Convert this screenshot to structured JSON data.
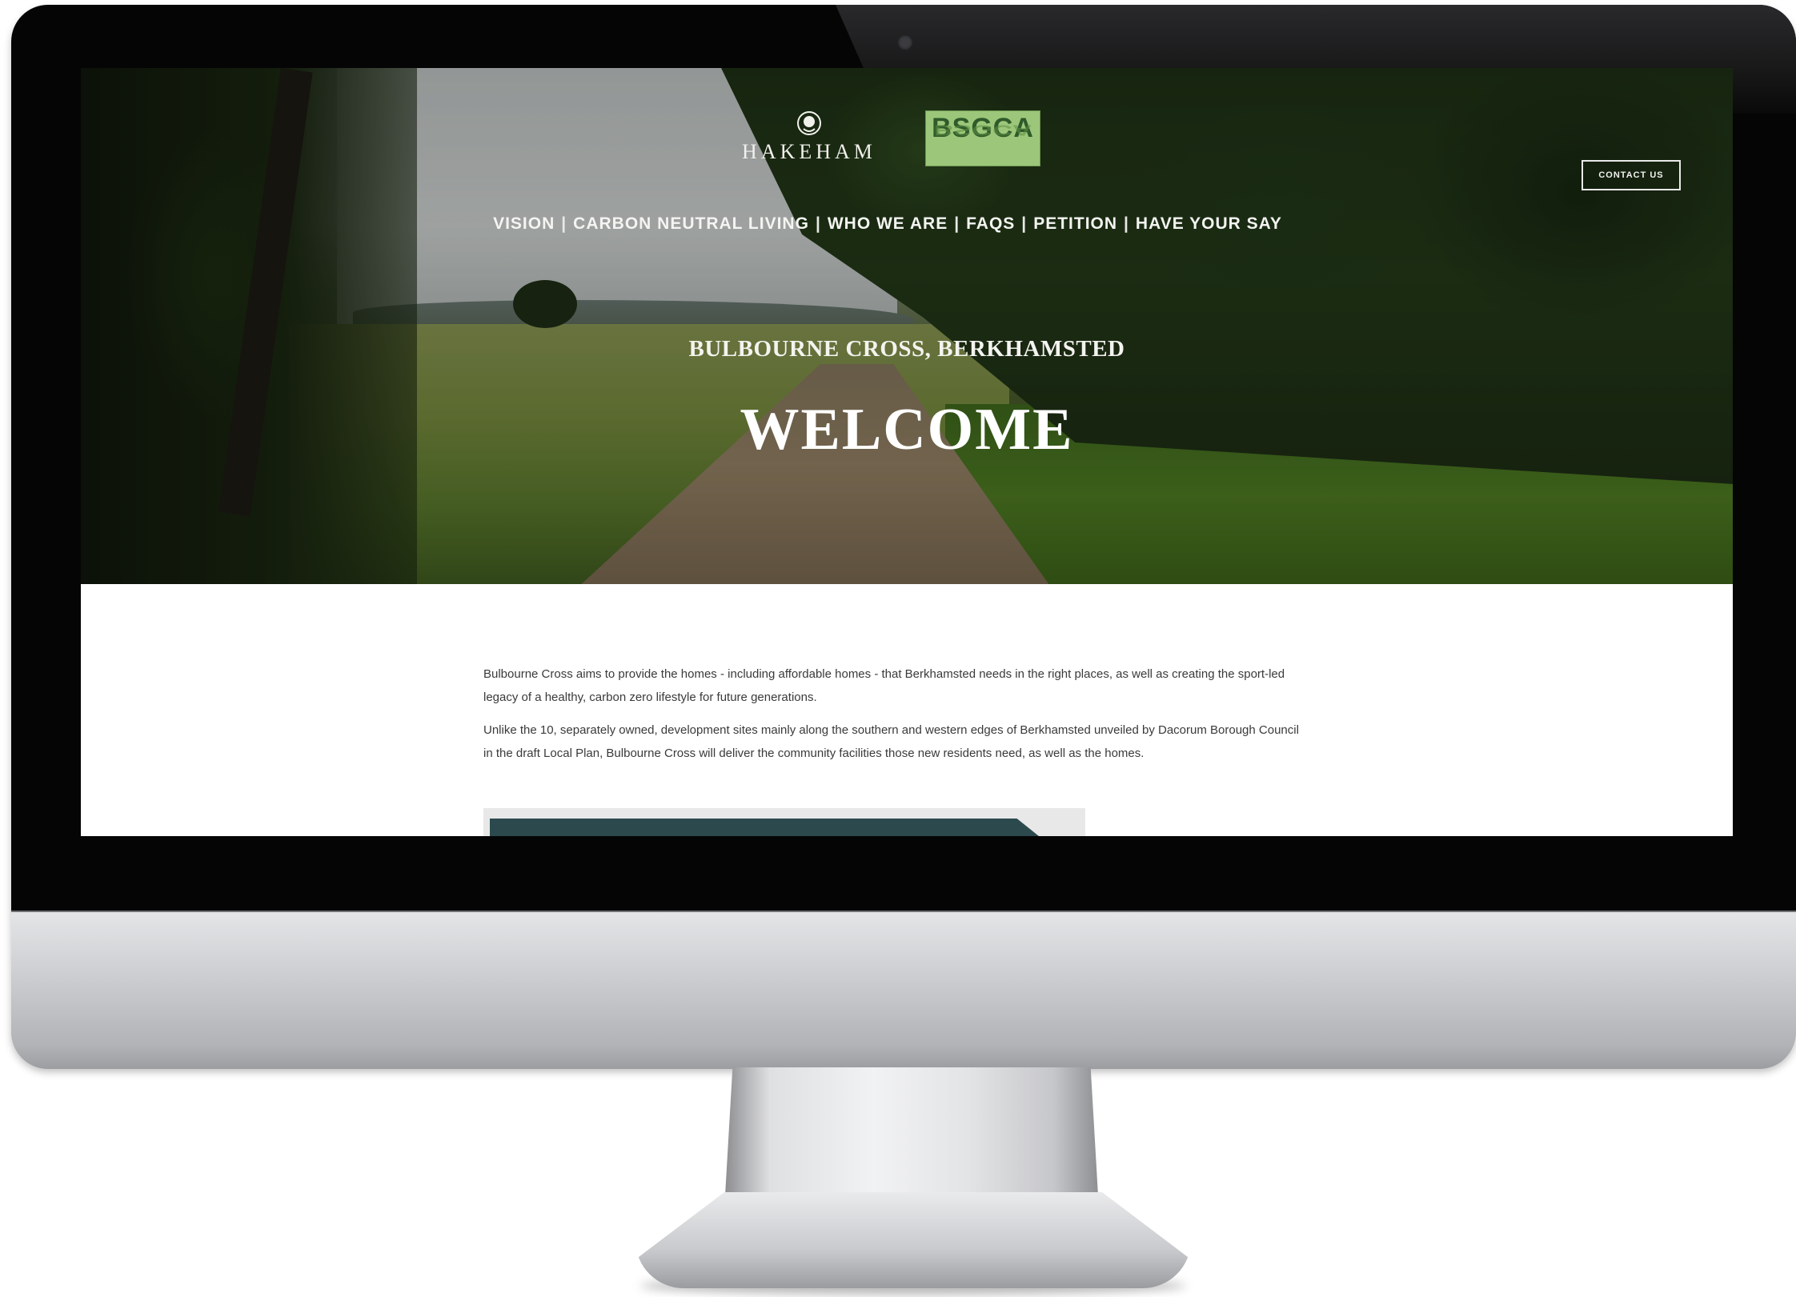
{
  "header": {
    "logo_hakeham": "HAKEHAM",
    "logo_bsgca": "BSGCA",
    "contact_label": "CONTACT US"
  },
  "nav": {
    "items": [
      "VISION",
      "CARBON NEUTRAL LIVING",
      "WHO WE ARE",
      "FAQS",
      "PETITION",
      "HAVE YOUR SAY"
    ],
    "separator": "|"
  },
  "hero": {
    "subtitle": "BULBOURNE CROSS, BERKHAMSTED",
    "title": "WELCOME"
  },
  "content": {
    "paragraph1": "Bulbourne Cross aims to provide the homes - including affordable homes - that Berkhamsted needs in the right places, as well as creating the sport-led legacy of a healthy, carbon zero lifestyle for future generations.",
    "paragraph2": "Unlike the 10, separately owned, development sites mainly along the southern and western edges of Berkhamsted unveiled by Dacorum Borough Council in the draft Local Plan, Bulbourne Cross will deliver the community facilities those new residents need, as well as the homes."
  },
  "colors": {
    "bsgca_green": "#9cc77a",
    "preview_teal": "#2c4a4d"
  },
  "icons": {
    "hakeham_emblem": "lion-crest-icon",
    "camera": "camera-icon"
  }
}
